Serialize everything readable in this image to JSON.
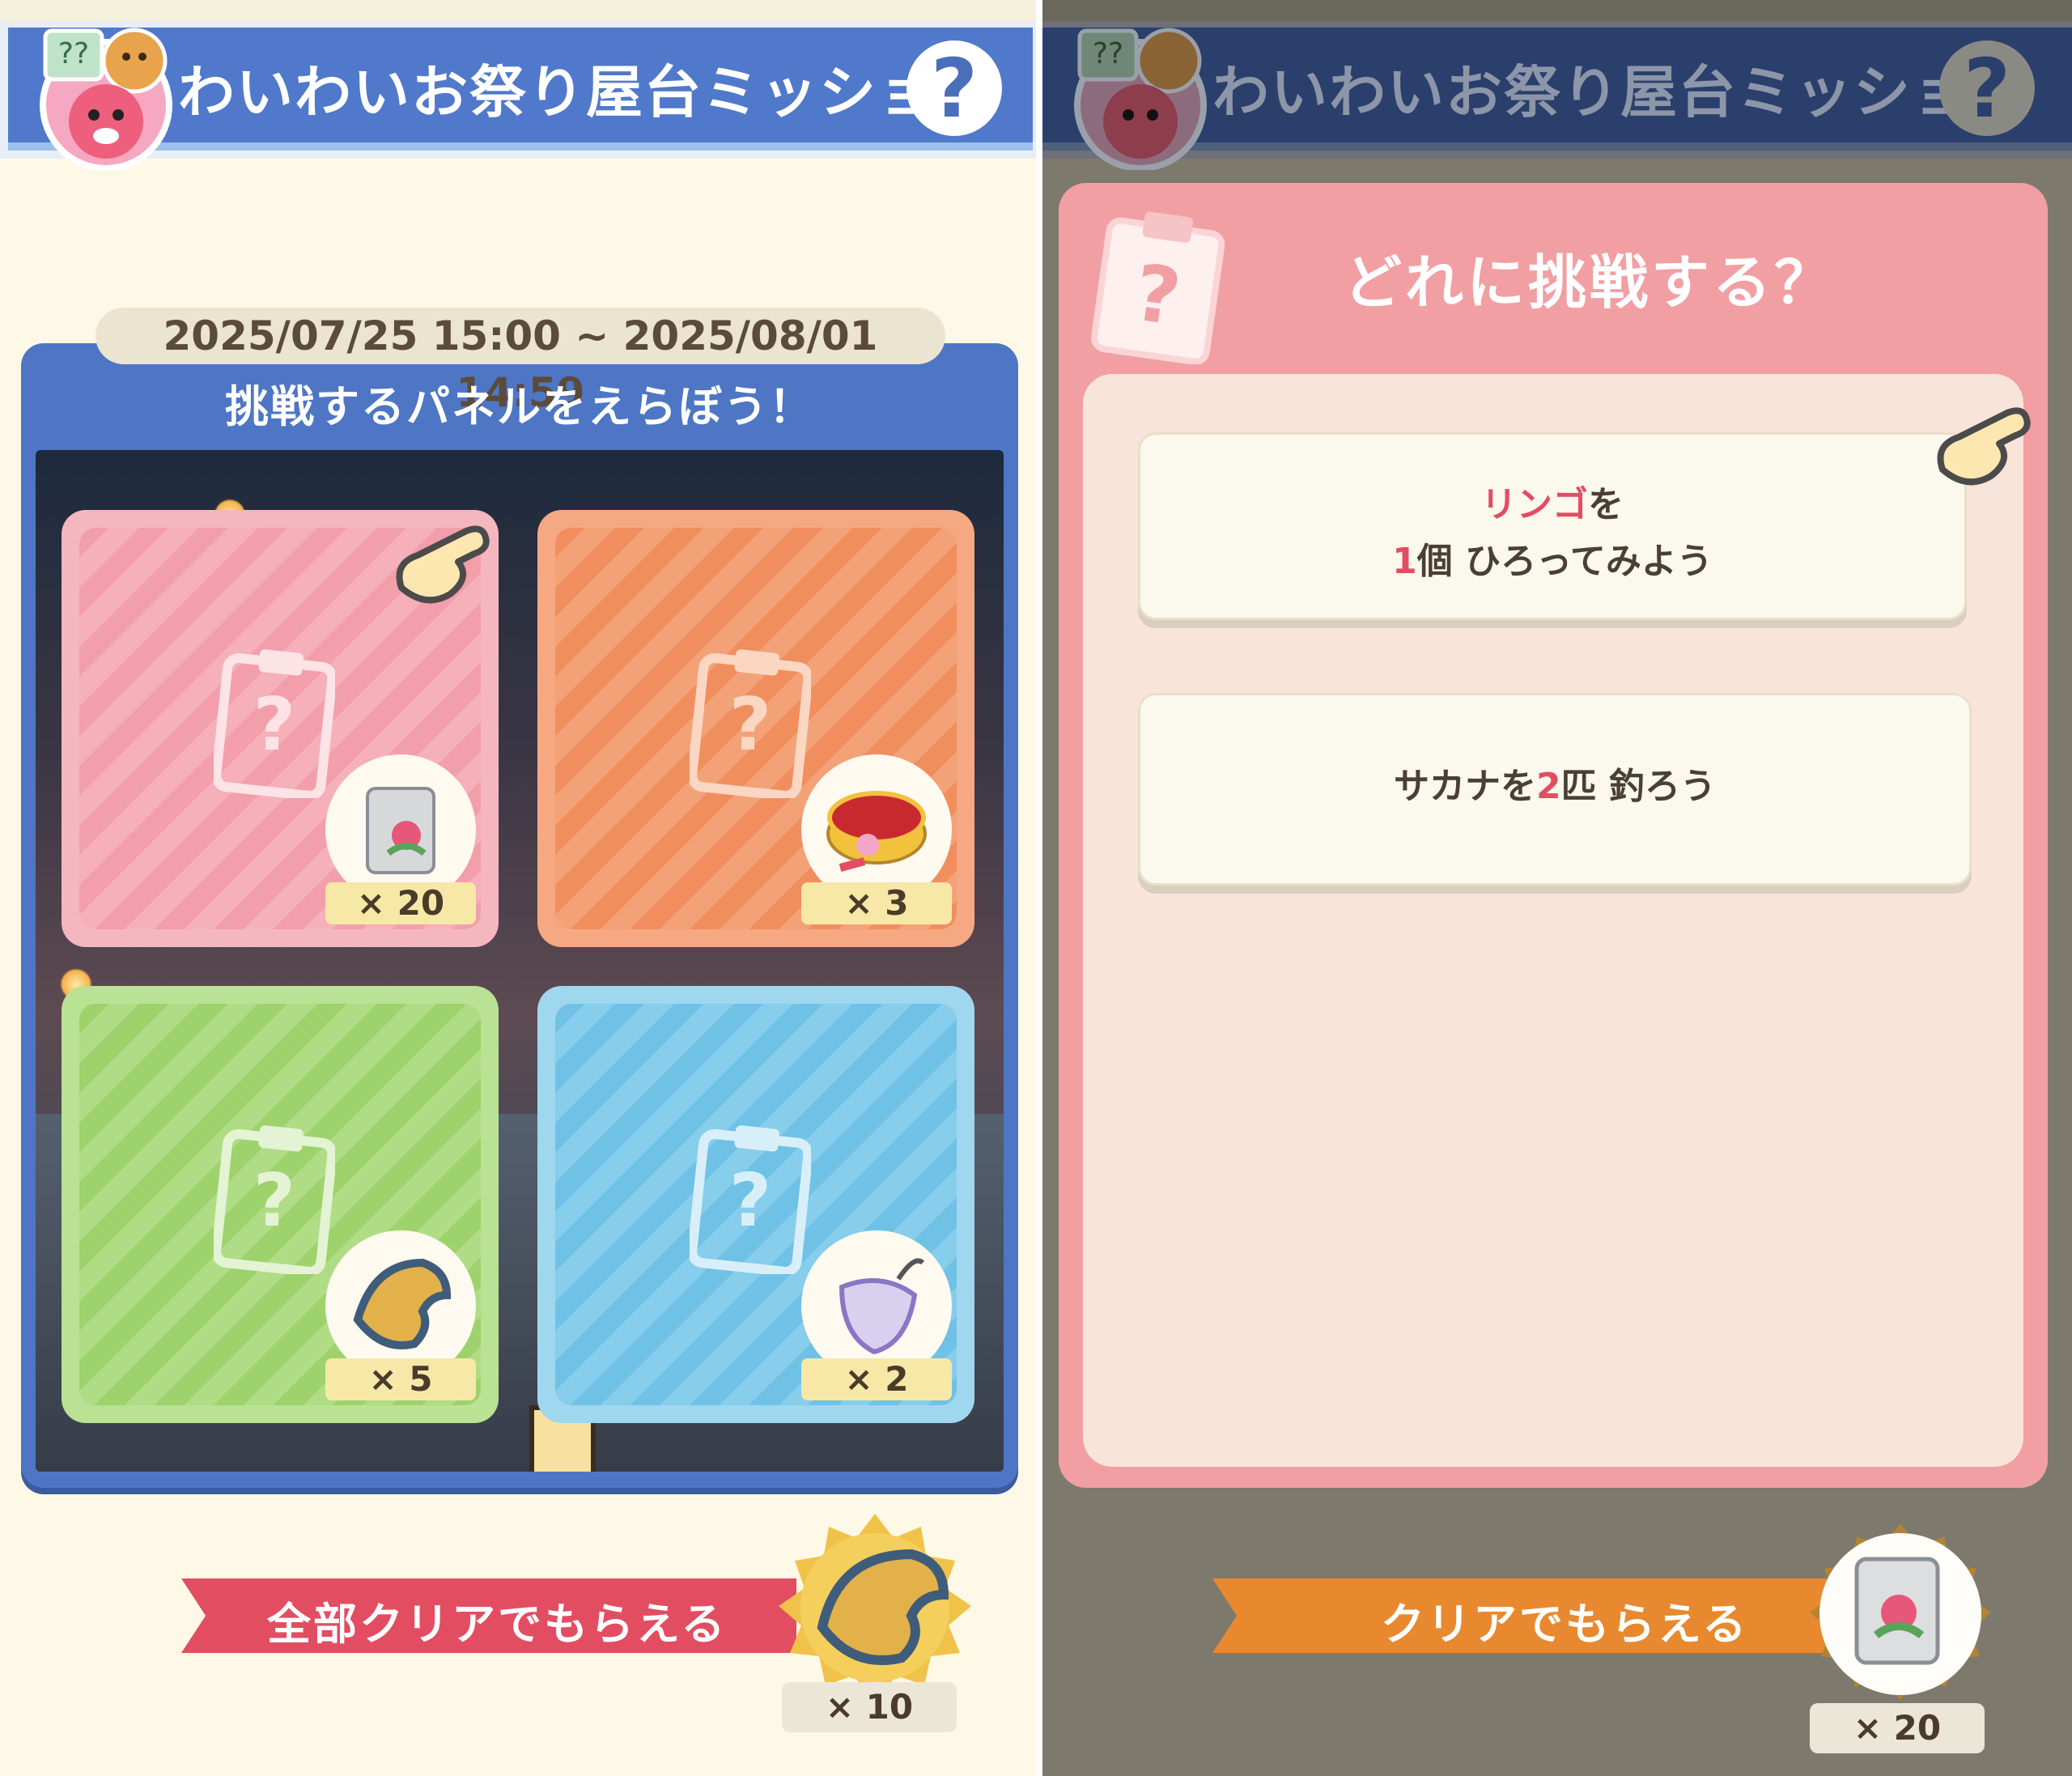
{
  "left": {
    "header": {
      "title": "わいわいお祭り屋台ミッション",
      "help_glyph": "?"
    },
    "period": "2025/07/25 15:00 ~ 2025/08/01 14:59",
    "panel_heading": "挑戦するパネルをえらぼう！",
    "tiles": [
      {
        "name": "pink",
        "color": "#f2a4ae",
        "reward_icon": "fertilizer-bag-icon",
        "count": "× 20",
        "selected": true
      },
      {
        "name": "orange",
        "color": "#f29a6a",
        "reward_icon": "candy-box-icon",
        "count": "× 3",
        "selected": false
      },
      {
        "name": "green",
        "color": "#a6d878",
        "reward_icon": "leaf-ticket-icon",
        "count": "× 5",
        "selected": false
      },
      {
        "name": "blue",
        "color": "#7ec8e8",
        "reward_icon": "net-icon",
        "count": "× 2",
        "selected": false
      }
    ],
    "footer": {
      "label": "全部クリアでもらえる",
      "reward_icon": "leaf-ticket-icon",
      "count": "× 10"
    }
  },
  "right": {
    "header": {
      "title": "わいわいお祭り屋台ミッション",
      "help_glyph": "?"
    },
    "modal_title": "どれに挑戦する？",
    "options": [
      {
        "line1_em": "リンゴ",
        "line1_rest": "を",
        "line2_em": "1",
        "line2_rest": "個 ひろってみよう"
      },
      {
        "pre": "サカナを",
        "em": "2",
        "post": "匹 釣ろう"
      }
    ],
    "footer": {
      "label": "クリアでもらえる",
      "reward_icon": "fertilizer-bag-icon",
      "count": "× 20"
    }
  },
  "colors": {
    "header_blue": "#5079cb",
    "header_blue_dim": "#2b3f6c",
    "accent_red": "#e34d62",
    "accent_orange": "#e8892f",
    "modal_pink": "#f19fa3"
  }
}
